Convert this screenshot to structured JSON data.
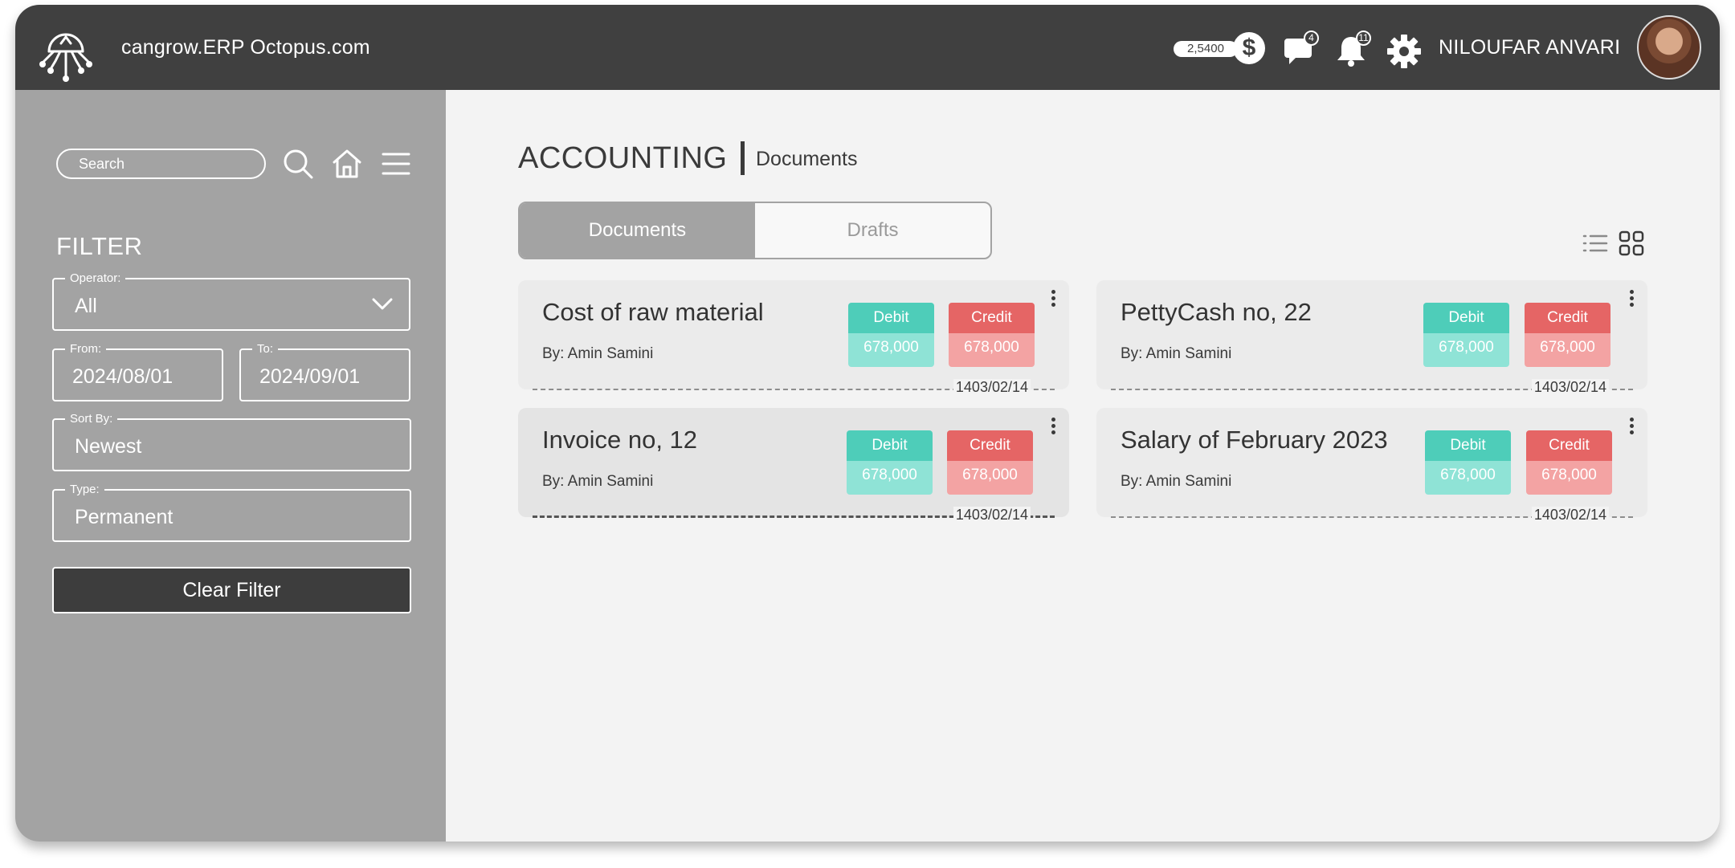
{
  "header": {
    "app_title": "cangrow.ERP Octopus.com",
    "wallet_balance": "2,5400",
    "wallet_symbol": "$",
    "messages_count": "4",
    "notifications_count": "11",
    "user_name": "NILOUFAR ANVARI"
  },
  "sidebar": {
    "search_placeholder": "Search",
    "filter_title": "FILTER",
    "fields": {
      "operator": {
        "label": "Operator:",
        "value": "All"
      },
      "from": {
        "label": "From:",
        "value": "2024/08/01"
      },
      "to": {
        "label": "To:",
        "value": "2024/09/01"
      },
      "sort_by": {
        "label": "Sort By:",
        "value": "Newest"
      },
      "type": {
        "label": "Type:",
        "value": "Permanent"
      }
    },
    "clear_button": "Clear Filter"
  },
  "main": {
    "page_title": "ACCOUNTING",
    "breadcrumb": "Documents",
    "tabs": [
      {
        "label": "Documents",
        "active": true
      },
      {
        "label": "Drafts",
        "active": false
      }
    ],
    "debit_label": "Debit",
    "credit_label": "Credit",
    "cards": [
      {
        "title": "Cost of raw material",
        "by": "By: Amin Samini",
        "debit": "678,000",
        "credit": "678,000",
        "date": "1403/02/14"
      },
      {
        "title": "PettyCash no, 22",
        "by": "By: Amin Samini",
        "debit": "678,000",
        "credit": "678,000",
        "date": "1403/02/14"
      },
      {
        "title": "Invoice no, 12",
        "by": "By: Amin Samini",
        "debit": "678,000",
        "credit": "678,000",
        "date": "1403/02/14"
      },
      {
        "title": "Salary of February 2023",
        "by": "By: Amin Samini",
        "debit": "678,000",
        "credit": "678,000",
        "date": "1403/02/14"
      }
    ]
  },
  "colors": {
    "header_bg": "#404040",
    "sidebar_bg": "#a3a3a3",
    "content_bg": "#f3f3f3",
    "debit": "#4ecdb9",
    "credit": "#e56565"
  },
  "icons": [
    "octopus-logo-icon",
    "dollar-icon",
    "chat-icon",
    "bell-icon",
    "gear-icon",
    "search-icon",
    "home-icon",
    "menu-icon",
    "chevron-down-icon",
    "list-view-icon",
    "grid-view-icon",
    "kebab-icon"
  ]
}
